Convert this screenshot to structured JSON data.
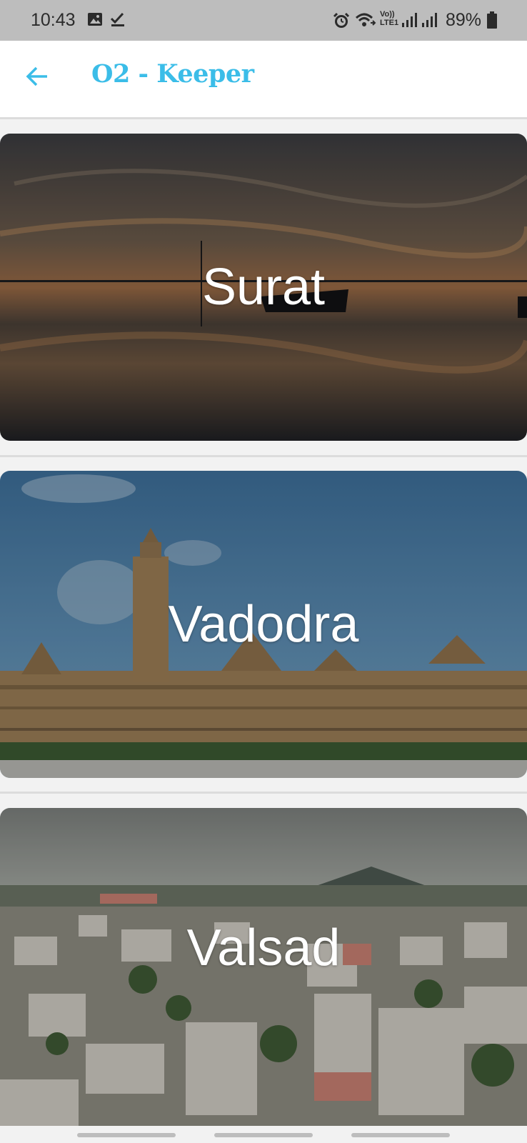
{
  "status_bar": {
    "time": "10:43",
    "battery_percent": "89%",
    "left_icons": [
      "image-icon",
      "check-icon"
    ],
    "right_icons": [
      "alarm-icon",
      "wifi-calling-icon",
      "volte-icon",
      "signal-icon",
      "signal-icon",
      "battery-icon"
    ],
    "volte_text_top": "Vo))",
    "volte_text_bottom": "LTE1"
  },
  "app_bar": {
    "title": "O2 - Keeper",
    "back_icon": "arrow-left-icon",
    "accent_color": "#3bbde8"
  },
  "cities": [
    {
      "name": "Surat"
    },
    {
      "name": "Vadodra"
    },
    {
      "name": "Valsad"
    }
  ]
}
